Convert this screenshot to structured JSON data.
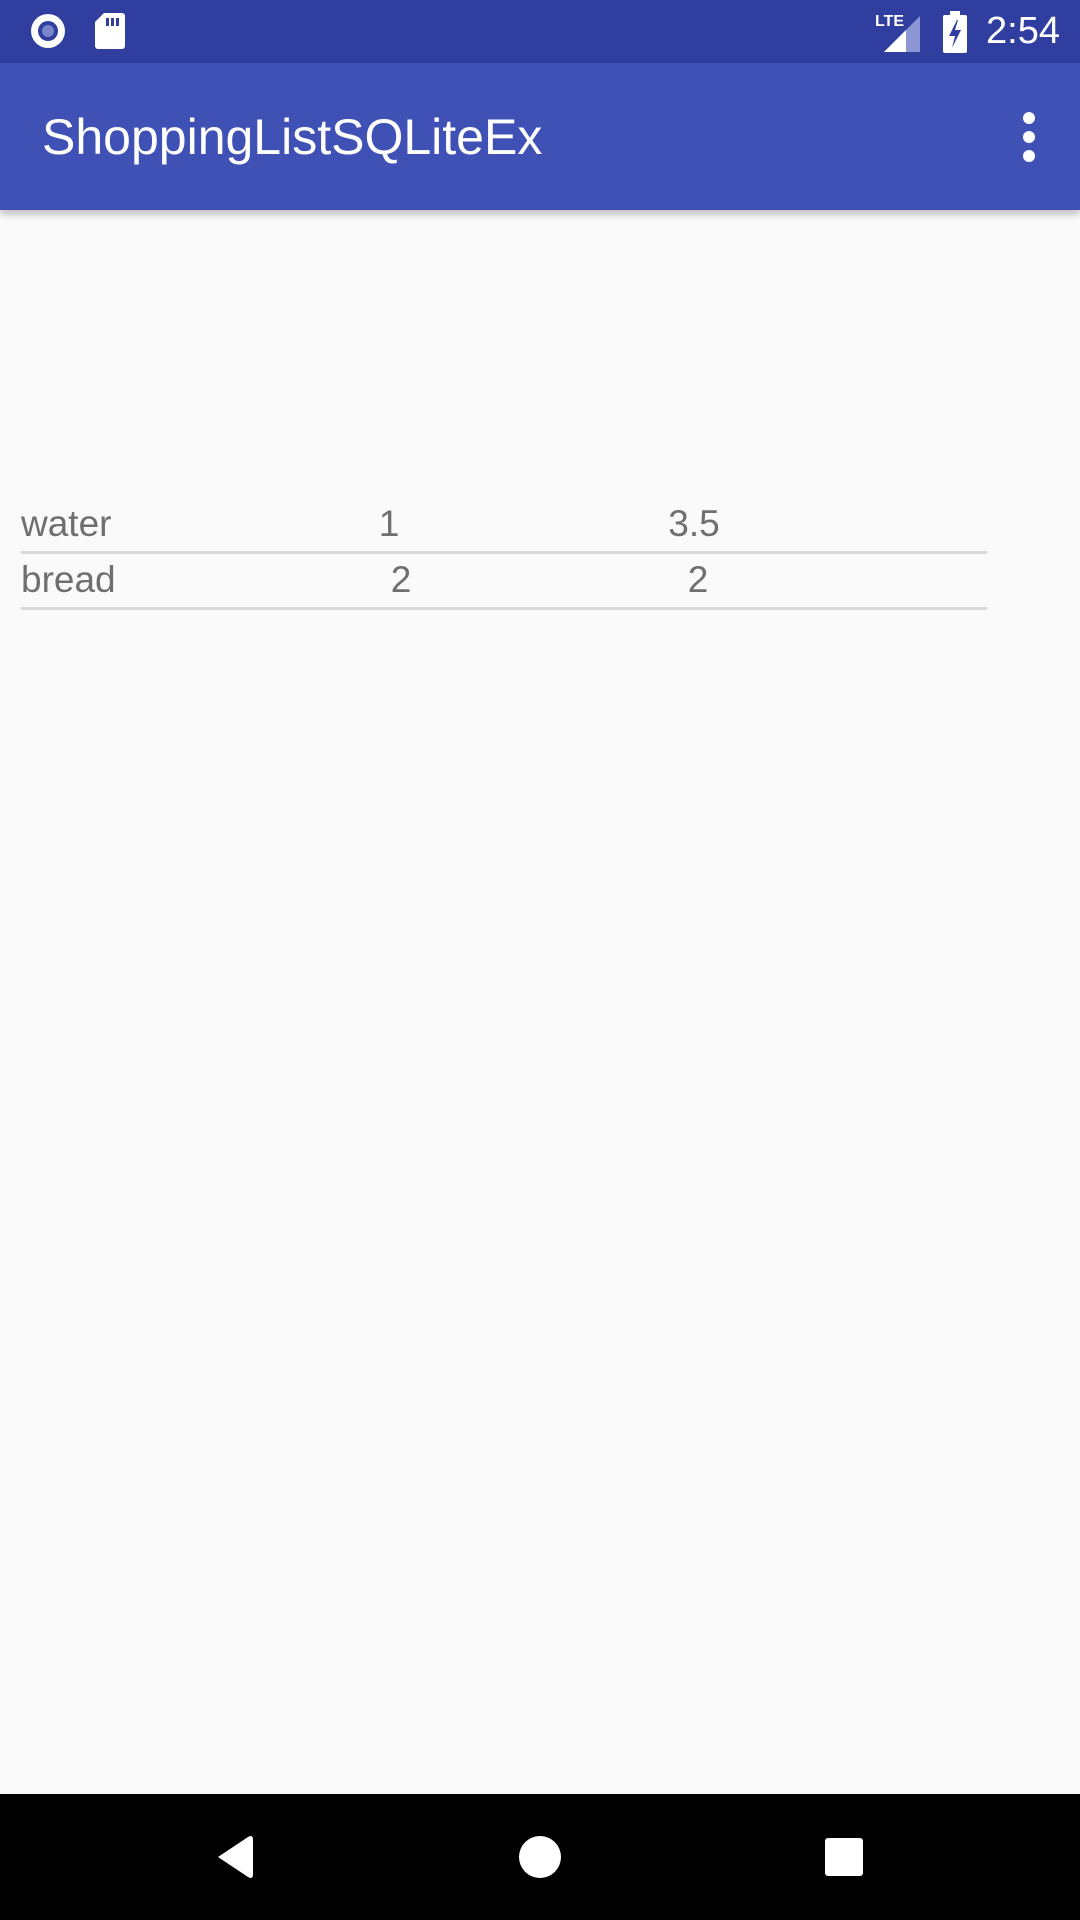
{
  "status_bar": {
    "time": "2:54",
    "network": "LTE",
    "left_icons": [
      "radio-icon",
      "sd-card-icon"
    ],
    "right_icons": [
      "lte-signal-icon",
      "battery-charging-icon"
    ]
  },
  "app_bar": {
    "title": "ShoppingListSQLiteEx",
    "overflow_icon": "more-vert-icon"
  },
  "list": {
    "items": [
      {
        "name": "water",
        "quantity": "1",
        "price": "3.5"
      },
      {
        "name": "bread",
        "quantity": "2",
        "price": "2"
      }
    ]
  },
  "nav_bar": {
    "icons": [
      "back-icon",
      "home-icon",
      "recents-icon"
    ]
  },
  "colors": {
    "status_bar": "#303f9f",
    "app_bar": "#3f51b5",
    "background": "#fafafa",
    "list_text": "#6f6f6f",
    "divider": "#d8d8d8",
    "nav_bar": "#000000"
  }
}
